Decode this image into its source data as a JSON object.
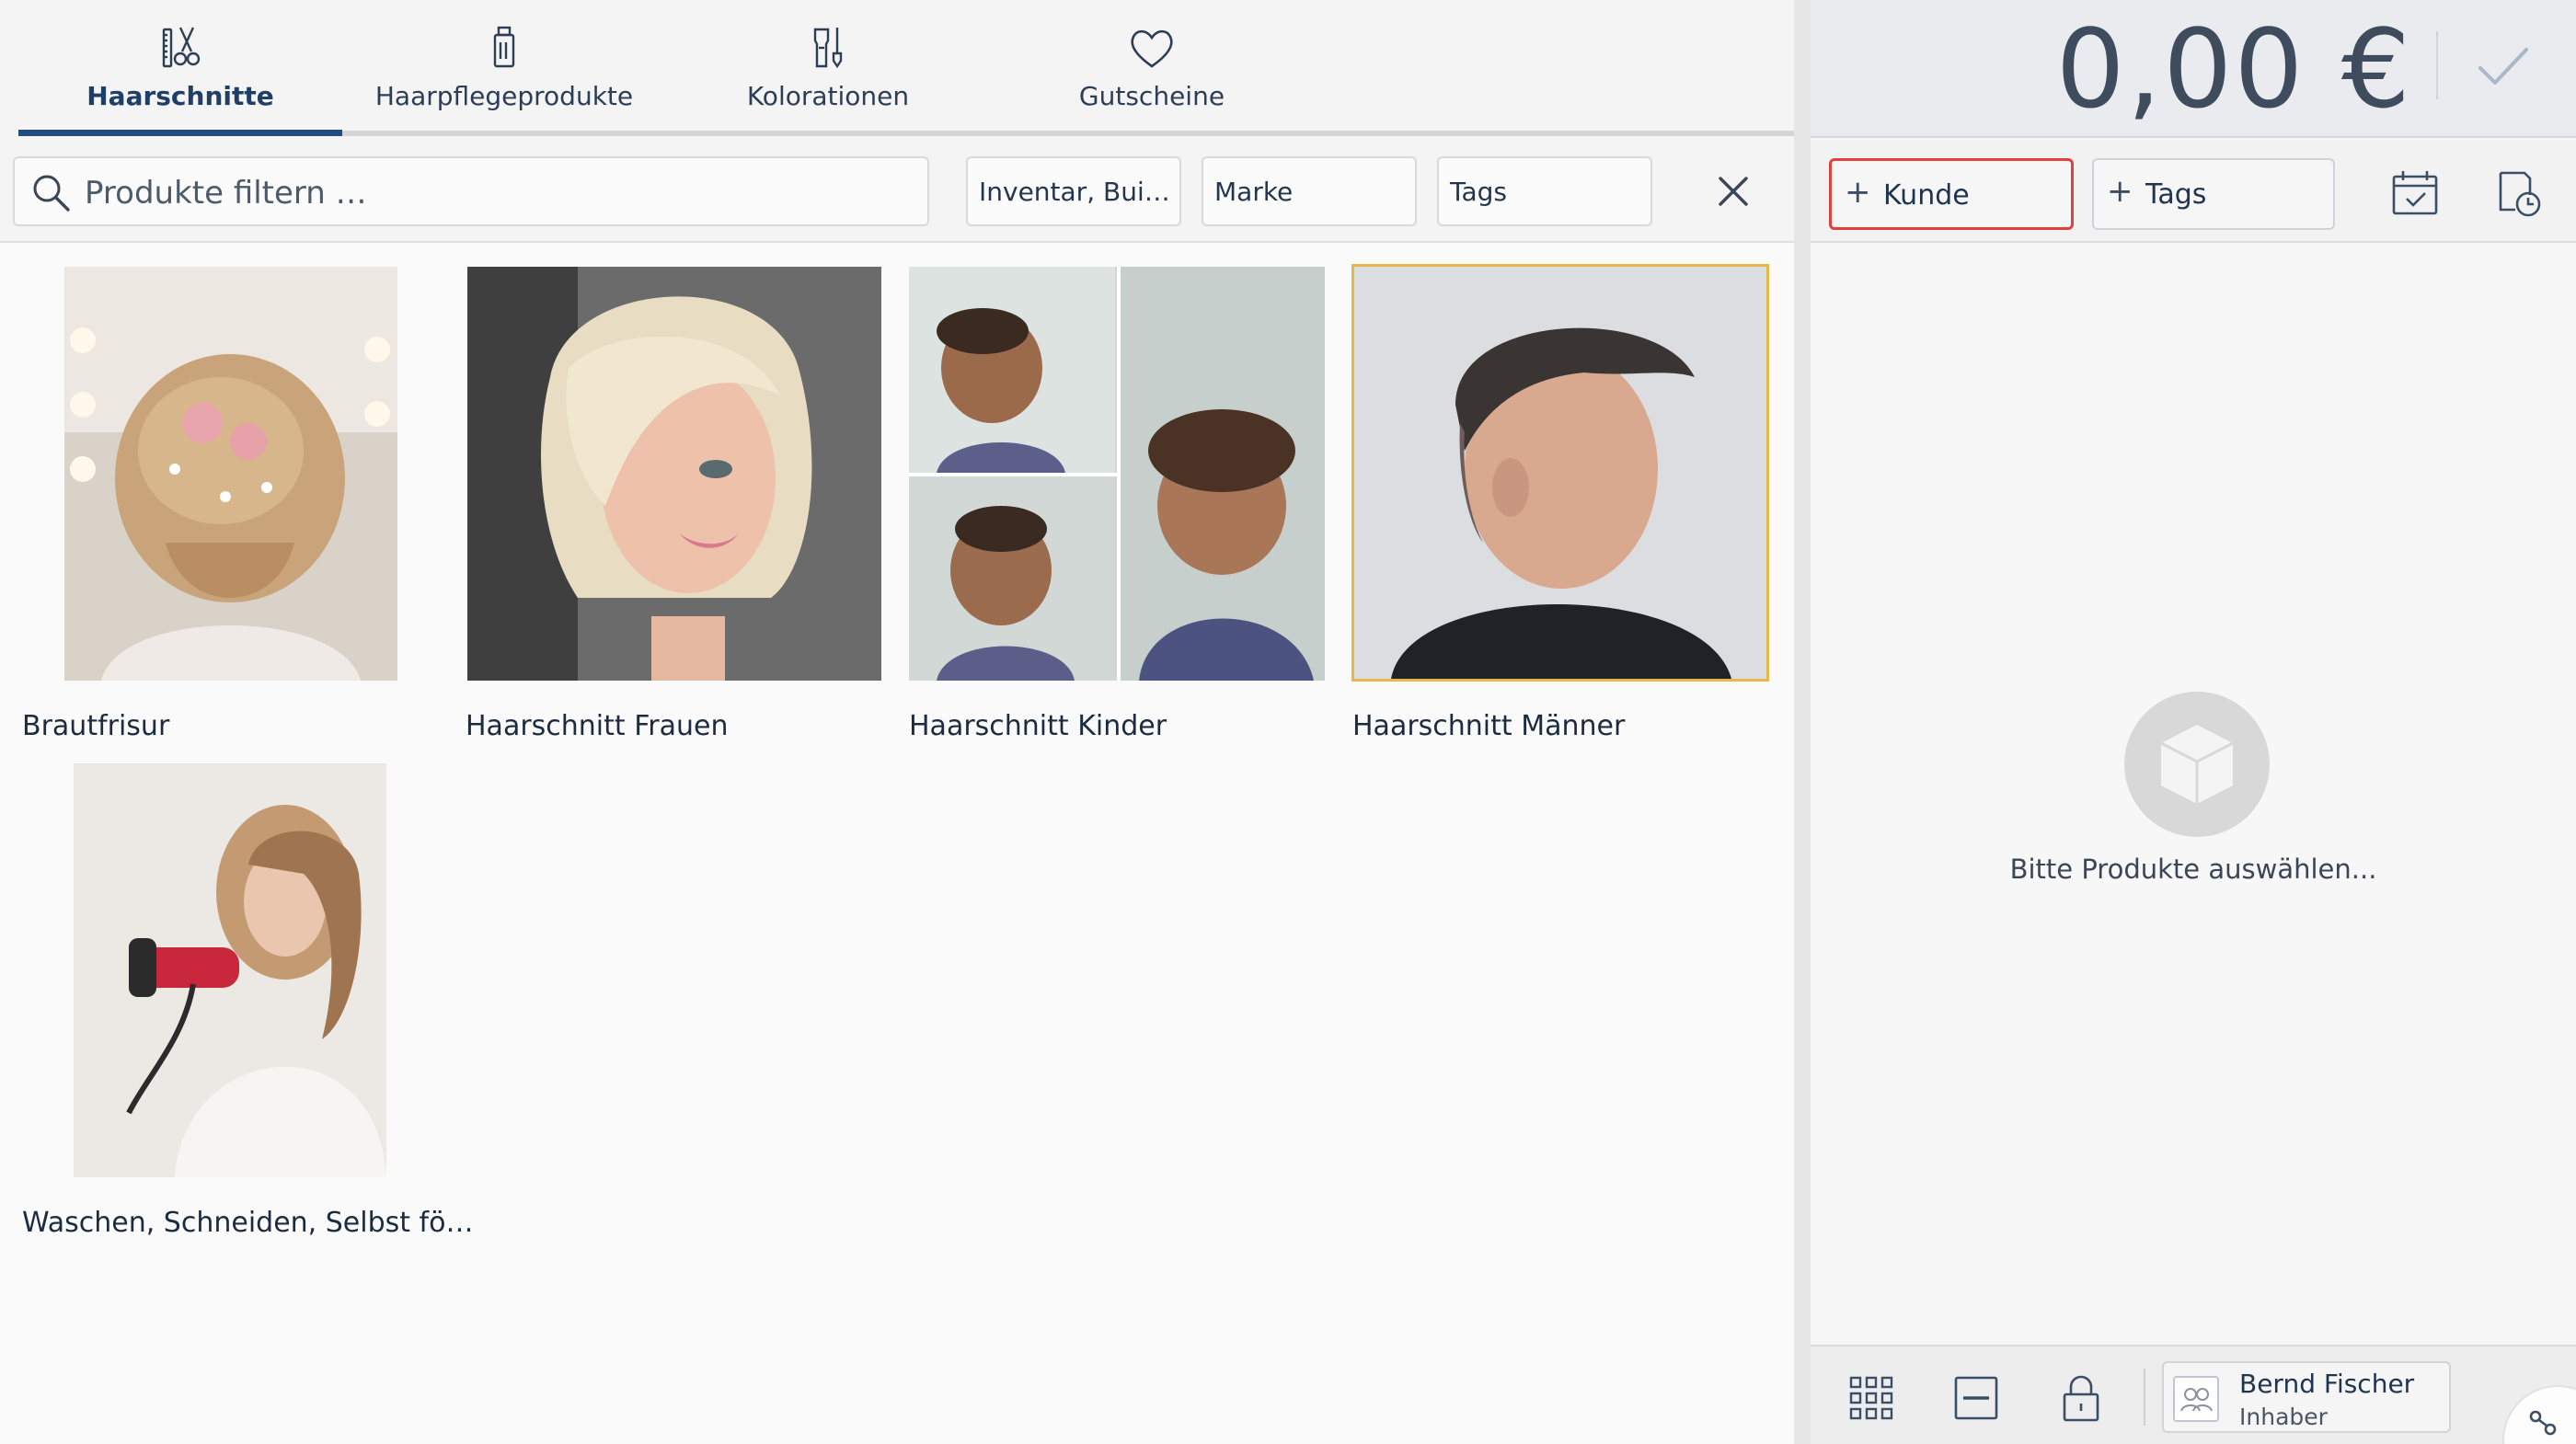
{
  "tabs": [
    {
      "label": "Haarschnitte",
      "icon": "scissors-comb-icon",
      "active": true
    },
    {
      "label": "Haarpflegeprodukte",
      "icon": "hair-product-bottle-icon",
      "active": false
    },
    {
      "label": "Kolorationen",
      "icon": "coloring-bottle-brush-icon",
      "active": false
    },
    {
      "label": "Gutscheine",
      "icon": "heart-icon",
      "active": false
    }
  ],
  "filters": {
    "search_placeholder": "Produkte filtern …",
    "category": "Inventar, Bui…",
    "brand": "Marke",
    "tags": "Tags"
  },
  "products": [
    {
      "name": "Brautfrisur"
    },
    {
      "name": "Haarschnitt Frauen"
    },
    {
      "name": "Haarschnitt Kinder"
    },
    {
      "name": "Haarschnitt Männer",
      "selected": true
    },
    {
      "name": "Waschen, Schneiden, Selbst fö…"
    }
  ],
  "cart": {
    "total": "0,00 €",
    "customer_label": "Kunde",
    "tags_label": "Tags",
    "empty_text": "Bitte Produkte auswählen..."
  },
  "user": {
    "name": "Bernd Fischer",
    "role": "Inhaber"
  },
  "colors": {
    "accent": "#1f4c82",
    "highlight_border": "#e0413a",
    "selected_outline": "#e6b84a"
  }
}
